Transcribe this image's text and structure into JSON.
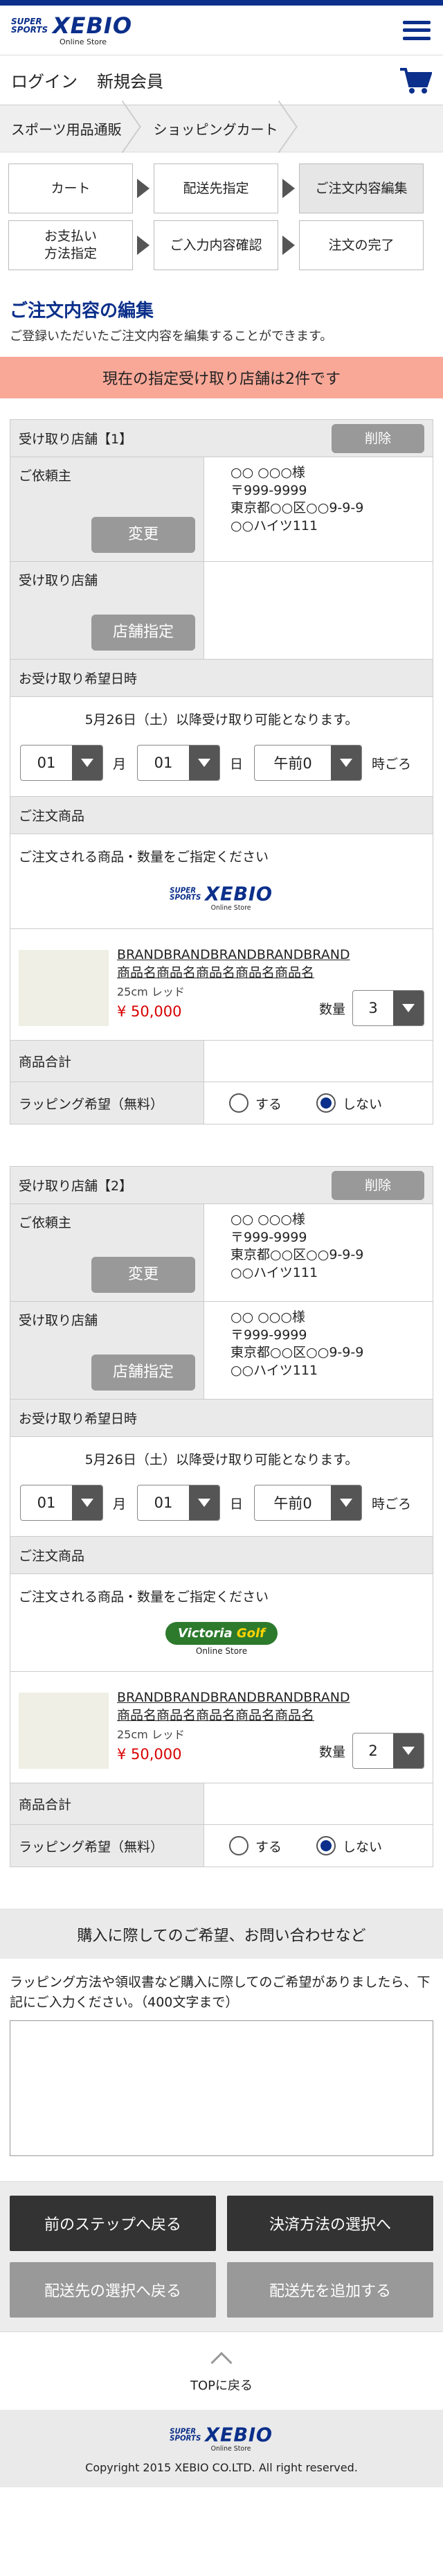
{
  "header": {
    "logo_super": "SUPER SPORTS",
    "logo_brand": "XEBIO",
    "logo_online": "Online Store",
    "menu_icon": "hamburger-menu-icon",
    "login": "ログイン",
    "register": "新規会員",
    "cart_icon": "cart-icon"
  },
  "breadcrumb": [
    "スポーツ用品通販",
    "ショッピングカート"
  ],
  "steps": {
    "row1": [
      "カート",
      "配送先指定",
      "ご注文内容編集"
    ],
    "row2": [
      "お支払い\n方法指定",
      "ご入力内容確認",
      "注文の完了"
    ],
    "active": "ご注文内容編集"
  },
  "page": {
    "title": "ご注文内容の編集",
    "desc": "ご登録いただいたご注文内容を編集することができます。",
    "notice": "現在の指定受け取り店舗は2件です"
  },
  "labels": {
    "delete": "削除",
    "requester": "ご依頼主",
    "change": "変更",
    "pickup_store": "受け取り店舗",
    "store_select": "店舗指定",
    "pickup_date": "お受け取り希望日時",
    "month": "月",
    "day": "日",
    "around": "時ごろ",
    "ordered_items": "ご注文商品",
    "items_intro": "ご注文される商品・数量をご指定ください",
    "qty": "数量",
    "subtotal": "商品合計",
    "wrapping": "ラッピング希望（無料）",
    "yes": "する",
    "no": "しない"
  },
  "stores": [
    {
      "title": "受け取り店舗【1】",
      "requester_name": "○○ ○○○様",
      "requester_zip": "〒999-9999",
      "requester_addr": "東京都○○区○○9-9-9",
      "requester_bldg": "○○ハイツ111",
      "store_name": "",
      "store_zip": "",
      "store_addr": "",
      "store_bldg": "",
      "date_note": "5月26日（土）以降受け取り可能となります。",
      "month": "01",
      "day": "01",
      "time": "午前0",
      "brand_logo": "xebio",
      "item_brand": "BRANDBRANDBRANDBRANDBRAND",
      "item_name": "商品名商品名商品名商品名商品名",
      "item_spec": "25cm レッド",
      "item_price": "¥ 50,000",
      "qty": "3",
      "subtotal": "",
      "wrapping": "no"
    },
    {
      "title": "受け取り店舗【2】",
      "requester_name": "○○ ○○○様",
      "requester_zip": "〒999-9999",
      "requester_addr": "東京都○○区○○9-9-9",
      "requester_bldg": "○○ハイツ111",
      "store_name": "○○ ○○○様",
      "store_zip": "〒999-9999",
      "store_addr": "東京都○○区○○9-9-9",
      "store_bldg": "○○ハイツ111",
      "date_note": "5月26日（土）以降受け取り可能となります。",
      "month": "01",
      "day": "01",
      "time": "午前0",
      "brand_logo": "victoria-golf",
      "brand_logo_text_1": "Victoria",
      "brand_logo_text_2": "Golf",
      "brand_logo_text_3": "Online Store",
      "item_brand": "BRANDBRANDBRANDBRANDBRAND",
      "item_name": "商品名商品名商品名商品名商品名",
      "item_spec": "25cm レッド",
      "item_price": "¥ 50,000",
      "qty": "2",
      "subtotal": "",
      "wrapping": "no"
    }
  ],
  "inquiry": {
    "title": "購入に際してのご希望、お問い合わせなど",
    "desc": "ラッピング方法や領収書など購入に際してのご希望がありましたら、下記にご入力ください。（400文字まで）",
    "value": ""
  },
  "nav": {
    "back": "前のステップへ戻る",
    "next": "決済方法の選択へ",
    "back_delivery": "配送先の選択へ戻る",
    "add_delivery": "配送先を追加する"
  },
  "totop": "TOPに戻る",
  "footer": {
    "copyright": "Copyright 2015 XEBIO CO.LTD. All right reserved."
  },
  "colors": {
    "brand_blue": "#0b2f8a",
    "notice_bg": "#f9a898",
    "price_red": "#d80000",
    "button_dark": "#333333",
    "button_gray": "#999999"
  }
}
